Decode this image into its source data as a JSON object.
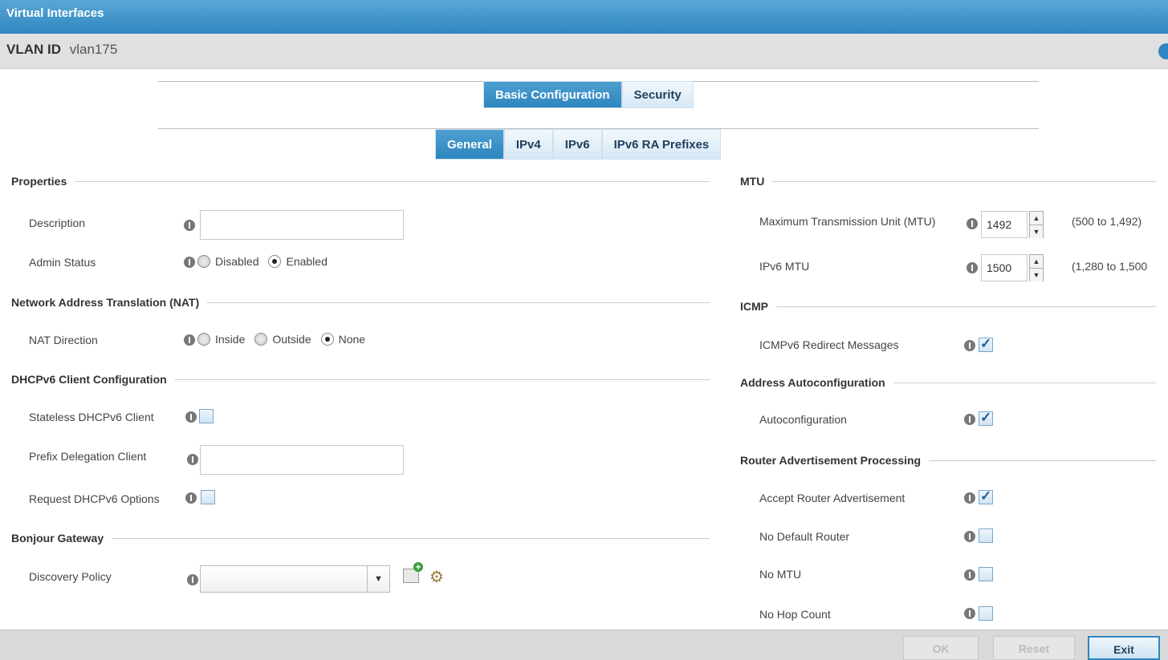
{
  "window": {
    "title": "Virtual Interfaces"
  },
  "header": {
    "key": "VLAN ID",
    "value": "vlan175"
  },
  "tabs": [
    {
      "label": "Basic Configuration",
      "active": true
    },
    {
      "label": "Security",
      "active": false
    }
  ],
  "subtabs": [
    {
      "label": "General",
      "active": true
    },
    {
      "label": "IPv4",
      "active": false
    },
    {
      "label": "IPv6",
      "active": false
    },
    {
      "label": "IPv6 RA Prefixes",
      "active": false
    }
  ],
  "left": {
    "properties": {
      "title": "Properties",
      "description": {
        "label": "Description",
        "value": ""
      },
      "admin_status": {
        "label": "Admin Status",
        "options": [
          "Disabled",
          "Enabled"
        ],
        "selected": "Enabled"
      }
    },
    "nat": {
      "title": "Network Address Translation (NAT)",
      "direction": {
        "label": "NAT Direction",
        "options": [
          "Inside",
          "Outside",
          "None"
        ],
        "selected": "None"
      }
    },
    "dhcpv6": {
      "title": "DHCPv6 Client Configuration",
      "stateless": {
        "label": "Stateless DHCPv6 Client",
        "checked": false
      },
      "prefix_delegation": {
        "label": "Prefix Delegation Client",
        "value": ""
      },
      "request_options": {
        "label": "Request DHCPv6 Options",
        "checked": false
      }
    },
    "bonjour": {
      "title": "Bonjour Gateway",
      "discovery_policy": {
        "label": "Discovery Policy",
        "value": ""
      }
    }
  },
  "right": {
    "mtu": {
      "title": "MTU",
      "mtu": {
        "label": "Maximum Transmission Unit (MTU)",
        "value": "1492",
        "range": "(500 to 1,492)"
      },
      "ipv6_mtu": {
        "label": "IPv6 MTU",
        "value": "1500",
        "range": "(1,280 to 1,500"
      }
    },
    "icmp": {
      "title": "ICMP",
      "redirect": {
        "label": "ICMPv6 Redirect Messages",
        "checked": true
      }
    },
    "autoconf": {
      "title": "Address Autoconfiguration",
      "autoconfiguration": {
        "label": "Autoconfiguration",
        "checked": true
      }
    },
    "router_adv": {
      "title": "Router Advertisement Processing",
      "accept": {
        "label": "Accept Router Advertisement",
        "checked": true
      },
      "no_default_router": {
        "label": "No Default Router",
        "checked": false
      },
      "no_mtu": {
        "label": "No MTU",
        "checked": false
      },
      "no_hop_count": {
        "label": "No Hop Count",
        "checked": false
      }
    }
  },
  "footer": {
    "ok": "OK",
    "reset": "Reset",
    "exit": "Exit"
  },
  "colors": {
    "accent": "#2e86c1",
    "tab_active": "#2d86bf"
  }
}
